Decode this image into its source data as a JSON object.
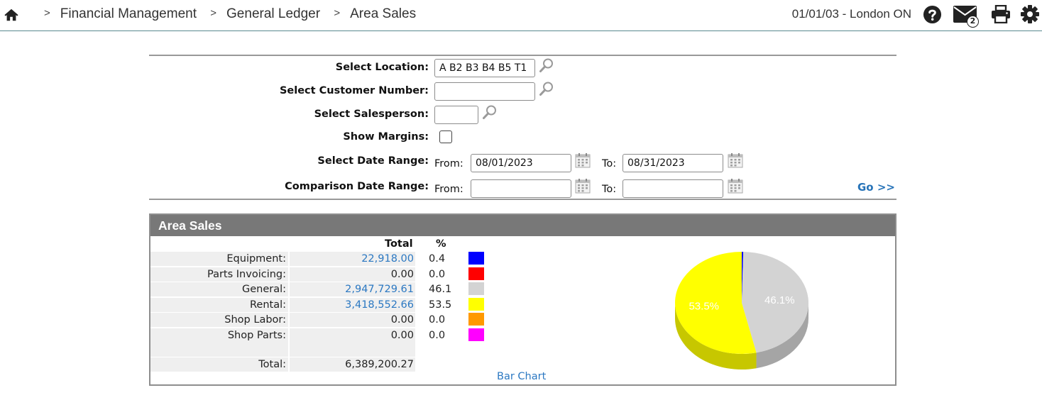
{
  "breadcrumb": {
    "separator": ">",
    "items": [
      "Financial Management",
      "General Ledger",
      "Area Sales"
    ]
  },
  "header": {
    "date_location": "01/01/03 - London ON",
    "mail_count": "2",
    "icons": [
      "home-icon",
      "help-icon",
      "mail-icon",
      "print-icon",
      "gear-icon"
    ]
  },
  "form": {
    "location": {
      "label": "Select Location:",
      "value": "A B2 B3 B4 B5 T1"
    },
    "customer": {
      "label": "Select Customer Number:",
      "value": ""
    },
    "salesperson": {
      "label": "Select Salesperson:",
      "value": ""
    },
    "margins": {
      "label": "Show Margins:",
      "checked": false
    },
    "date_range": {
      "label": "Select Date Range:",
      "from_label": "From:",
      "from": "08/01/2023",
      "to_label": "To:",
      "to": "08/31/2023"
    },
    "comparison_range": {
      "label": "Comparison Date Range:",
      "from_label": "From:",
      "from": "",
      "to_label": "To:",
      "to": ""
    },
    "go_label": "Go >>"
  },
  "panel": {
    "title": "Area Sales",
    "col_total": "Total",
    "col_pct": "%",
    "rows": [
      {
        "label": "Equipment:",
        "total": "22,918.00",
        "pct": "0.4",
        "color": "#0000ff",
        "link": true
      },
      {
        "label": "Parts Invoicing:",
        "total": "0.00",
        "pct": "0.0",
        "color": "#ff0000",
        "link": false
      },
      {
        "label": "General:",
        "total": "2,947,729.61",
        "pct": "46.1",
        "color": "#d3d3d3",
        "link": true
      },
      {
        "label": "Rental:",
        "total": "3,418,552.66",
        "pct": "53.5",
        "color": "#ffff00",
        "link": true
      },
      {
        "label": "Shop Labor:",
        "total": "0.00",
        "pct": "0.0",
        "color": "#ff9900",
        "link": false
      },
      {
        "label": "Shop Parts:",
        "total": "0.00",
        "pct": "0.0",
        "color": "#ff00ff",
        "link": false
      }
    ],
    "total_label": "Total:",
    "total_value": "6,389,200.27",
    "bar_chart_label": "Bar Chart"
  },
  "chart_data": {
    "type": "pie",
    "categories": [
      "Equipment",
      "Parts Invoicing",
      "General",
      "Rental",
      "Shop Labor",
      "Shop Parts"
    ],
    "values": [
      22918.0,
      0.0,
      2947729.61,
      3418552.66,
      0.0,
      0.0
    ],
    "colors": [
      "#0000ff",
      "#ff0000",
      "#d3d3d3",
      "#ffff00",
      "#ff9900",
      "#ff00ff"
    ],
    "slice_labels": [
      "",
      "",
      "46.1%",
      "53.5%",
      "",
      ""
    ]
  }
}
